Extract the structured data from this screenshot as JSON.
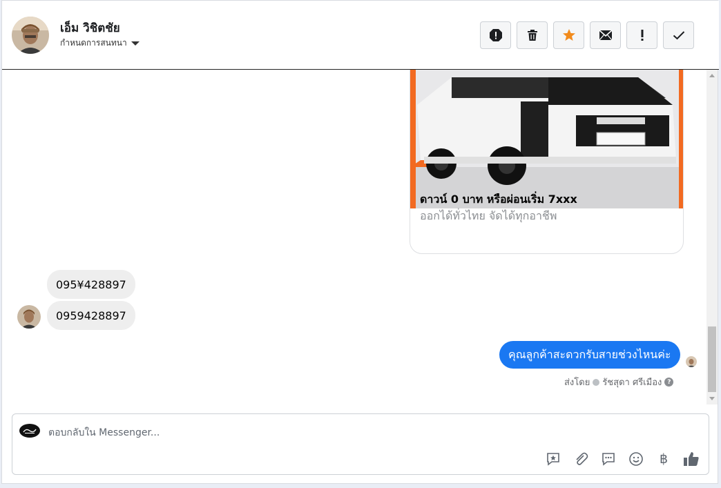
{
  "header": {
    "name": "เอ็ม วิชิตชัย",
    "assign_label": "กำหนดการสนทนา",
    "actions": [
      "spam-icon",
      "trash-icon",
      "star-icon",
      "envelope-icon",
      "exclamation-icon",
      "check-icon"
    ],
    "star_color": "#f28b1c"
  },
  "conversation": {
    "card": {
      "title": "ดาวน์ 0 บาท หรือผ่อนเริ่ม 7xxx",
      "subtitle": "ออกได้ทั่วไทย จัดได้ทุกอาชีพ"
    },
    "incoming": [
      {
        "text": "095¥428897"
      },
      {
        "text": "0959428897"
      }
    ],
    "outgoing": {
      "text": "คุณลูกค้าสะดวกรับสายช่วงไหนค่ะ",
      "color": "#1a78f2"
    },
    "sent_by_label": "ส่งโดย",
    "sent_by_name": "รัชสุดา ศรีเมือง"
  },
  "composer": {
    "placeholder": "ตอบกลับใน Messenger...",
    "baht_symbol": "฿",
    "tools": [
      "saved-reply-icon",
      "attachment-icon",
      "quick-reply-icon",
      "emoji-icon",
      "payment-icon",
      "like-icon"
    ]
  }
}
